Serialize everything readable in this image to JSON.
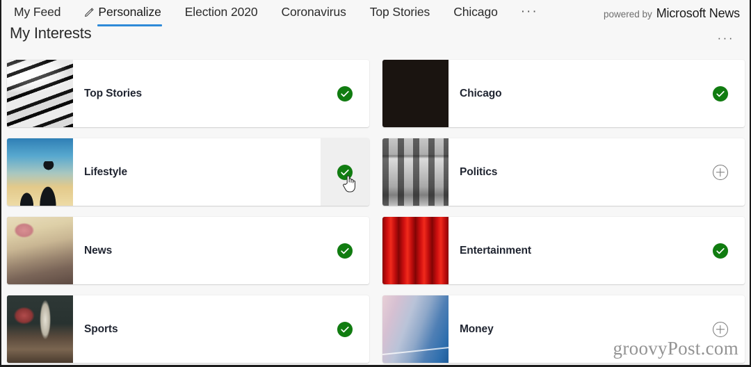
{
  "topnav": {
    "items": [
      {
        "label": "My Feed",
        "active": false,
        "icon": null
      },
      {
        "label": "Personalize",
        "active": true,
        "icon": "pencil-icon"
      },
      {
        "label": "Election 2020",
        "active": false,
        "icon": null
      },
      {
        "label": "Coronavirus",
        "active": false,
        "icon": null
      },
      {
        "label": "Top Stories",
        "active": false,
        "icon": null
      },
      {
        "label": "Chicago",
        "active": false,
        "icon": null
      }
    ],
    "overflow_label": "···",
    "powered_by": "powered by",
    "brand": "Microsoft News",
    "accent_color": "#2e8ad8"
  },
  "header": {
    "title": "My Interests",
    "more_label": "···"
  },
  "interests": [
    {
      "name": "Top Stories",
      "selected": true,
      "toggle_icon": "check-circle-icon",
      "thumb": "th-topstories",
      "hovered": false
    },
    {
      "name": "Chicago",
      "selected": true,
      "toggle_icon": "check-circle-icon",
      "thumb": "th-chicago",
      "hovered": false
    },
    {
      "name": "Lifestyle",
      "selected": true,
      "toggle_icon": "check-circle-icon",
      "thumb": "th-lifestyle",
      "hovered": true
    },
    {
      "name": "Politics",
      "selected": false,
      "toggle_icon": "plus-circle-icon",
      "thumb": "th-politics",
      "hovered": false
    },
    {
      "name": "News",
      "selected": true,
      "toggle_icon": "check-circle-icon",
      "thumb": "th-news",
      "hovered": false
    },
    {
      "name": "Entertainment",
      "selected": true,
      "toggle_icon": "check-circle-icon",
      "thumb": "th-entertainment",
      "hovered": false
    },
    {
      "name": "Sports",
      "selected": true,
      "toggle_icon": "check-circle-icon",
      "thumb": "th-sports",
      "hovered": false
    },
    {
      "name": "Money",
      "selected": false,
      "toggle_icon": "plus-circle-icon",
      "thumb": "th-money",
      "hovered": false
    }
  ],
  "colors": {
    "selected_green": "#107c10",
    "unselected_gray": "#767676",
    "page_background": "#f7f7f7",
    "card_background": "#ffffff",
    "hover_background": "#efefef"
  },
  "watermark": {
    "text": "groovyPost.com"
  }
}
